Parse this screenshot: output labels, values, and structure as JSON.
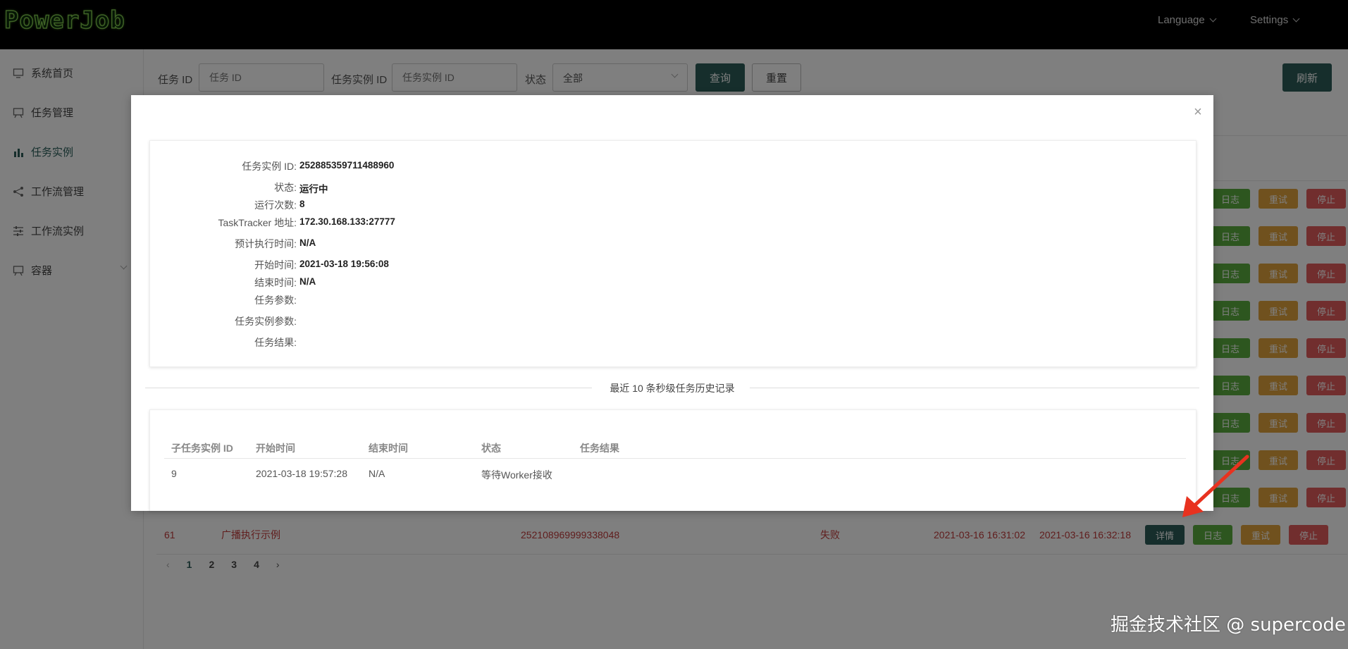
{
  "header": {
    "logo_text": "PowerJob",
    "language_label": "Language",
    "settings_label": "Settings"
  },
  "sidebar": {
    "items": [
      {
        "label": "系统首页",
        "icon": "monitor-icon"
      },
      {
        "label": "任务管理",
        "icon": "task-board-icon"
      },
      {
        "label": "任务实例",
        "icon": "bar-chart-icon"
      },
      {
        "label": "工作流管理",
        "icon": "share-icon"
      },
      {
        "label": "工作流实例",
        "icon": "sliders-icon"
      },
      {
        "label": "容器",
        "icon": "container-icon"
      }
    ]
  },
  "filters": {
    "task_id_label": "任务 ID",
    "task_id_placeholder": "任务 ID",
    "instance_id_label": "任务实例 ID",
    "instance_id_placeholder": "任务实例 ID",
    "status_label": "状态",
    "status_value": "全部",
    "query_button": "查询",
    "reset_button": "重置",
    "refresh_button": "刷新"
  },
  "row_actions": {
    "detail": "详情",
    "log": "日志",
    "retry": "重试",
    "stop": "停止"
  },
  "last_row": {
    "id": "61",
    "name": "广播执行示例",
    "instance_id": "252108969999338048",
    "status": "失败",
    "start_time": "2021-03-16 16:31:02",
    "end_time": "2021-03-16 16:32:18"
  },
  "pagination": {
    "pages": [
      "1",
      "2",
      "3",
      "4"
    ],
    "current": "1",
    "prev": "‹",
    "next": "›"
  },
  "modal": {
    "close": "×",
    "fields": [
      {
        "label": "任务实例 ID:",
        "value": "252885359711488960"
      },
      {
        "label": "状态:",
        "value": "运行中"
      },
      {
        "label": "运行次数:",
        "value": "8"
      },
      {
        "label": "TaskTracker 地址:",
        "value": "172.30.168.133:27777"
      },
      {
        "label": "预计执行时间:",
        "value": "N/A"
      },
      {
        "label": "开始时间:",
        "value": "2021-03-18 19:56:08"
      },
      {
        "label": "结束时间:",
        "value": "N/A"
      },
      {
        "label": "任务参数:",
        "value": ""
      },
      {
        "label": "任务实例参数:",
        "value": ""
      },
      {
        "label": "任务结果:",
        "value": ""
      }
    ],
    "history_title": "最近 10 条秒级任务历史记录",
    "history_headers": [
      "子任务实例 ID",
      "开始时间",
      "结束时间",
      "状态",
      "任务结果"
    ],
    "history_rows": [
      [
        "9",
        "2021-03-18 19:57:28",
        "N/A",
        "等待Worker接收",
        ""
      ]
    ]
  },
  "watermark": "掘金技术社区 @ supercode",
  "colors": {
    "primary": "#2d5d58",
    "log": "#5aad3f",
    "retry": "#e0a23c",
    "stop": "#e25c5c",
    "failed_text": "#c03b3b"
  }
}
